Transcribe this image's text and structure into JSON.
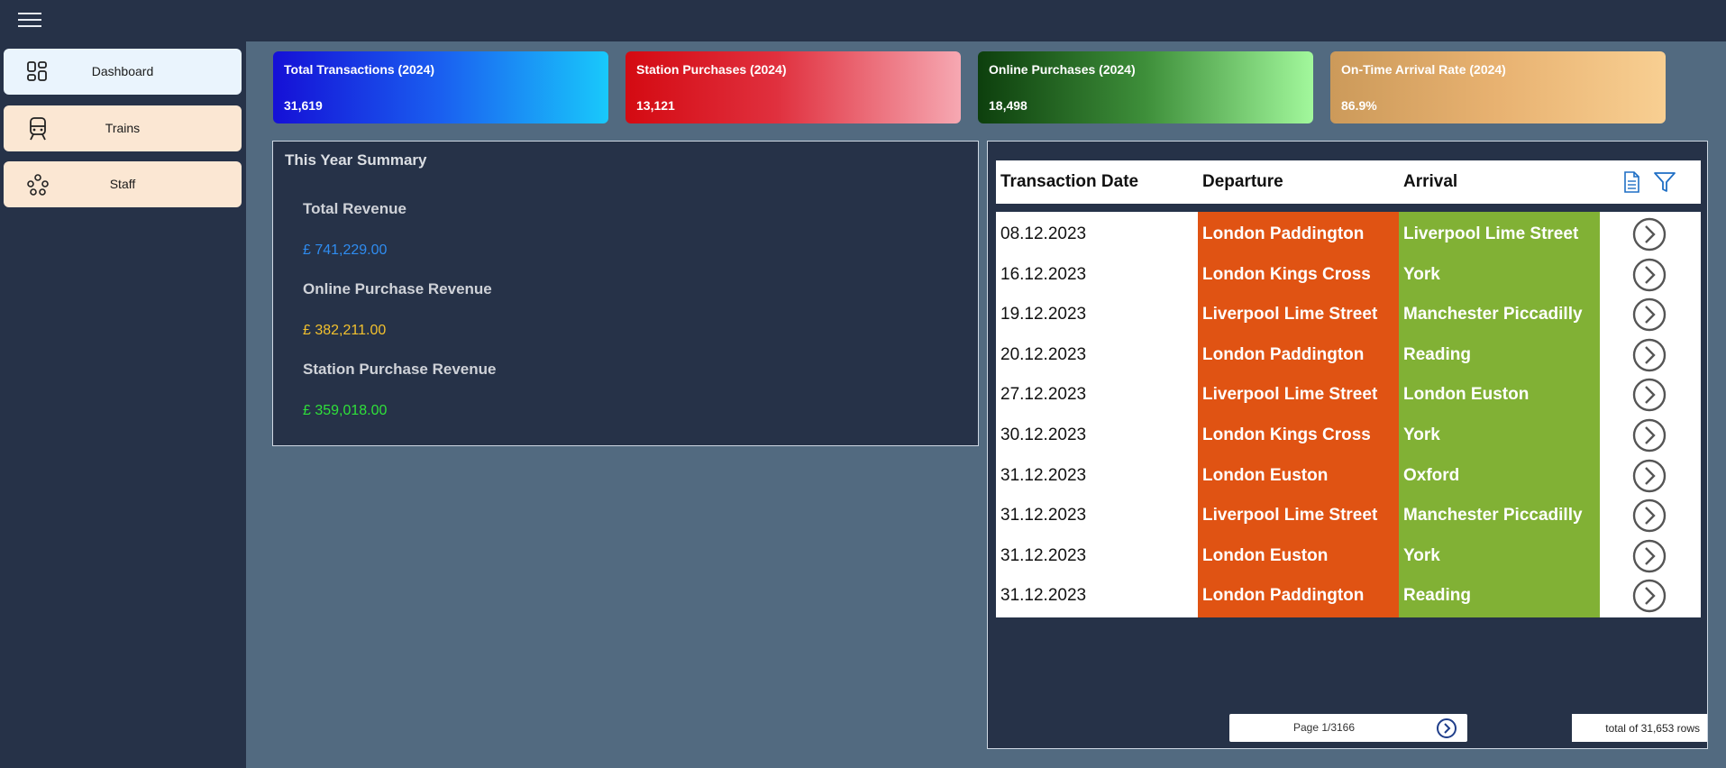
{
  "header": {
    "menu_icon": "hamburger-icon"
  },
  "sidebar": {
    "items": [
      {
        "label": "Dashboard",
        "icon": "dashboard-icon",
        "active": true
      },
      {
        "label": "Trains",
        "icon": "train-icon",
        "active": false
      },
      {
        "label": "Staff",
        "icon": "staff-icon",
        "active": false
      }
    ]
  },
  "kpis": [
    {
      "title": "Total Transactions (2024)",
      "value": "31,619"
    },
    {
      "title": "Station Purchases (2024)",
      "value": "13,121"
    },
    {
      "title": "Online Purchases (2024)",
      "value": "18,498"
    },
    {
      "title": "On-Time Arrival Rate (2024)",
      "value": "86.9%"
    }
  ],
  "summary": {
    "title": "This Year Summary",
    "items": [
      {
        "label": "Total Revenue",
        "value": "£ 741,229.00",
        "color": "#2f8cf0"
      },
      {
        "label": "Online Purchase Revenue",
        "value": "£ 382,211.00",
        "color": "#f2c12e"
      },
      {
        "label": "Station Purchase Revenue",
        "value": "£ 359,018.00",
        "color": "#2fe03a"
      }
    ]
  },
  "table": {
    "columns": [
      "Transaction Date",
      "Departure",
      "Arrival"
    ],
    "rows": [
      {
        "date": "08.12.2023",
        "departure": "London Paddington",
        "arrival": "Liverpool Lime Street"
      },
      {
        "date": "16.12.2023",
        "departure": "London Kings Cross",
        "arrival": "York"
      },
      {
        "date": "19.12.2023",
        "departure": "Liverpool Lime Street",
        "arrival": "Manchester Piccadilly"
      },
      {
        "date": "20.12.2023",
        "departure": "London Paddington",
        "arrival": "Reading"
      },
      {
        "date": "27.12.2023",
        "departure": "Liverpool Lime Street",
        "arrival": "London Euston"
      },
      {
        "date": "30.12.2023",
        "departure": "London Kings Cross",
        "arrival": "York"
      },
      {
        "date": "31.12.2023",
        "departure": "London Euston",
        "arrival": "Oxford"
      },
      {
        "date": "31.12.2023",
        "departure": "Liverpool Lime Street",
        "arrival": "Manchester Piccadilly"
      },
      {
        "date": "31.12.2023",
        "departure": "London Euston",
        "arrival": "York"
      },
      {
        "date": "31.12.2023",
        "departure": "London Paddington",
        "arrival": "Reading"
      }
    ],
    "pagination": {
      "text": "Page 1/3166"
    },
    "total_rows": "total of 31,653 rows"
  },
  "colors": {
    "departure_bg": "#e05313",
    "arrival_bg": "#81b135",
    "sidebar_bg": "#263248",
    "main_bg": "#526a80"
  }
}
